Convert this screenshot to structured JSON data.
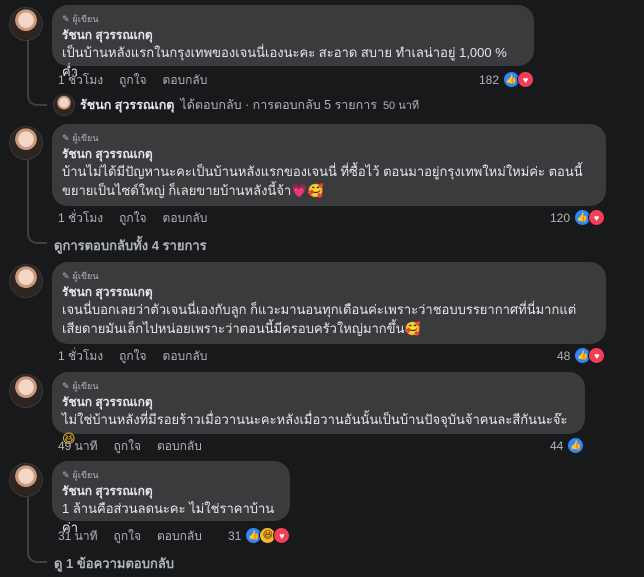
{
  "labels": {
    "author_badge": "ผู้เขียน",
    "like": "ถูกใจ",
    "reply": "ตอบกลับ"
  },
  "comments": [
    {
      "name": "รัชนก สุวรรณเกตุ",
      "text": "เป็นบ้านหลังแรกในกรุงเทพของเจนนี่เองนะคะ สะอาด สบาย ทำเลน่าอยู่ 1,000 % ค่ำ",
      "time": "1 ชั่วโมง",
      "reaction_count": "182",
      "reaction_types": [
        "like",
        "love"
      ]
    },
    {
      "name": "รัชนก สุวรรณเกตุ",
      "text_line1": "บ้านไม่ได้มีปัญหานะคะเป็นบ้านหลังแรกของเจนนี่ ที่ซื้อไว้ ตอนมาอยู่กรุงเทพใหม่ใหม่ค่ะ ตอนนี้",
      "text_line2": "ขยายเป็นไซด์ใหญ่ ก็เลยขายบ้านหลังนี้จ้า",
      "time": "1 ชั่วโมง",
      "reaction_count": "120",
      "reaction_types": [
        "like",
        "love"
      ]
    },
    {
      "name": "รัชนก สุวรรณเกตุ",
      "text_line1": "เจนนี่บอกเลยว่าตัวเจนนี่เองกับลูก ก็แวะมานอนทุกเดือนค่ะเพราะว่าชอบบรรยากาศที่นี่มากแต่",
      "text_line2": "เสียดายมันเล็กไปหน่อยเพราะว่าตอนนี้มีครอบครัวใหญ่มากขึ้น",
      "time": "1 ชั่วโมง",
      "reaction_count": "48",
      "reaction_types": [
        "like",
        "love"
      ]
    },
    {
      "name": "รัชนก สุวรรณเกตุ",
      "text": "ไม่ใช่บ้านหลังที่มีรอยร้าวเมื่อวานนะคะหลังเมื่อวานอันนั้นเป็นบ้านปัจจุบันจ้าคนละสีกันนะจ๊ะ",
      "time": "49 นาที",
      "reaction_count": "44",
      "reaction_types": [
        "like"
      ]
    },
    {
      "name": "รัชนก สุวรรณเกตุ",
      "text": "1 ล้านคือส่วนลดนะคะ ไม่ใช่ราคาบ้านค่า",
      "time": "31 นาที",
      "reaction_count": "31",
      "reaction_types": [
        "like",
        "haha",
        "love"
      ]
    }
  ],
  "reply_summary": {
    "name": "รัชนก สุวรรณเกตุ",
    "text": "ได้ตอบกลับ · การตอบกลับ 5 รายการ",
    "time": "50 นาที"
  },
  "view_all_replies": "ดูการตอบกลับทั้ง 4 รายการ",
  "view_one_reply": "ดู 1 ข้อความตอบกลับ"
}
